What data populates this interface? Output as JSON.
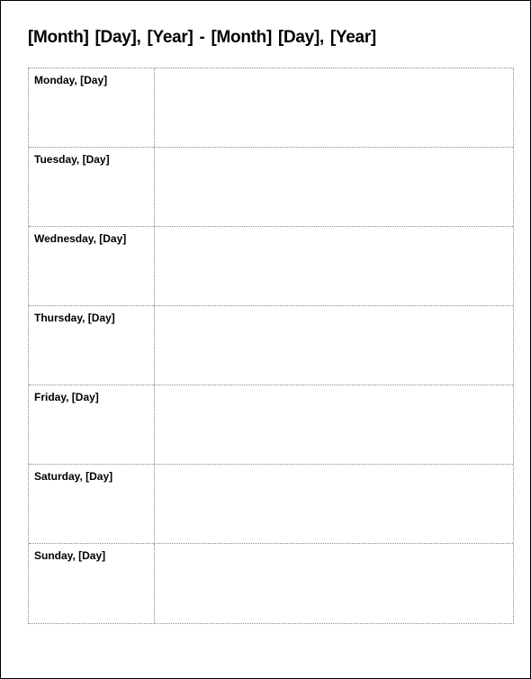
{
  "title": "[Month]  [Day], [Year] - [Month] [Day], [Year]",
  "days": [
    {
      "label": "Monday, [Day]"
    },
    {
      "label": "Tuesday, [Day]"
    },
    {
      "label": "Wednesday, [Day]"
    },
    {
      "label": "Thursday, [Day]"
    },
    {
      "label": "Friday, [Day]"
    },
    {
      "label": "Saturday, [Day]"
    },
    {
      "label": "Sunday, [Day]"
    }
  ]
}
